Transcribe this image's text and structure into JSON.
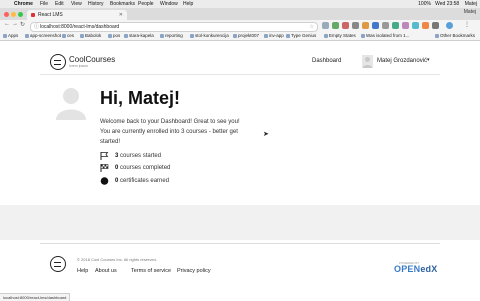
{
  "menubar": {
    "app": "Chrome",
    "items": [
      "File",
      "Edit",
      "View",
      "History",
      "Bookmarks",
      "People",
      "Window",
      "Help"
    ],
    "clock": "Wed 23:58",
    "battery": "100%",
    "user": "Matej"
  },
  "browser": {
    "tab_title": "React LMS",
    "profile_name": "Matej",
    "url": "localhost:8000/react-lms/dashboard",
    "bookmarks": [
      "Apps",
      "app-screenshot",
      "ces",
      "Babolok",
      "pos",
      "stara-kapela",
      "reporting",
      "stol-konkurencija",
      "projekt007",
      "inv-app",
      "Type Genius",
      "Empty States",
      "Was isolated from 1...",
      "Other Bookmarks"
    ]
  },
  "header": {
    "brand": "CoolCourses",
    "brand_sub": "lorem ipsum",
    "nav_dashboard": "Dashboard",
    "user_name": "Matej Grozdanović",
    "caret": "▾"
  },
  "main": {
    "greeting": "Hi, Matej!",
    "welcome_line1": "Welcome back to your Dashboard! Great to see you!",
    "welcome_line2": "You are currently enrolled into 3 courses - better get started!",
    "stats": [
      {
        "icon": "flag-icon",
        "count": "3",
        "label": "courses started"
      },
      {
        "icon": "checkered-flag-icon",
        "count": "0",
        "label": "courses completed"
      },
      {
        "icon": "certificate-icon",
        "count": "0",
        "label": "certificates earned"
      }
    ]
  },
  "footer": {
    "copyright": "© 2018 Cool Courses Inc. All rights reserved.",
    "links": [
      "Help",
      "About us",
      "Terms of service",
      "Privacy policy"
    ],
    "powered_by": "POWERED BY",
    "openedx_main": "OPEN",
    "openedx_x": "edX"
  },
  "statusbar": {
    "url": "localhost:8000/react-lms/dashboard"
  },
  "colors": {
    "openedx": "#3a7bc8",
    "band": "#f1f1f1"
  }
}
